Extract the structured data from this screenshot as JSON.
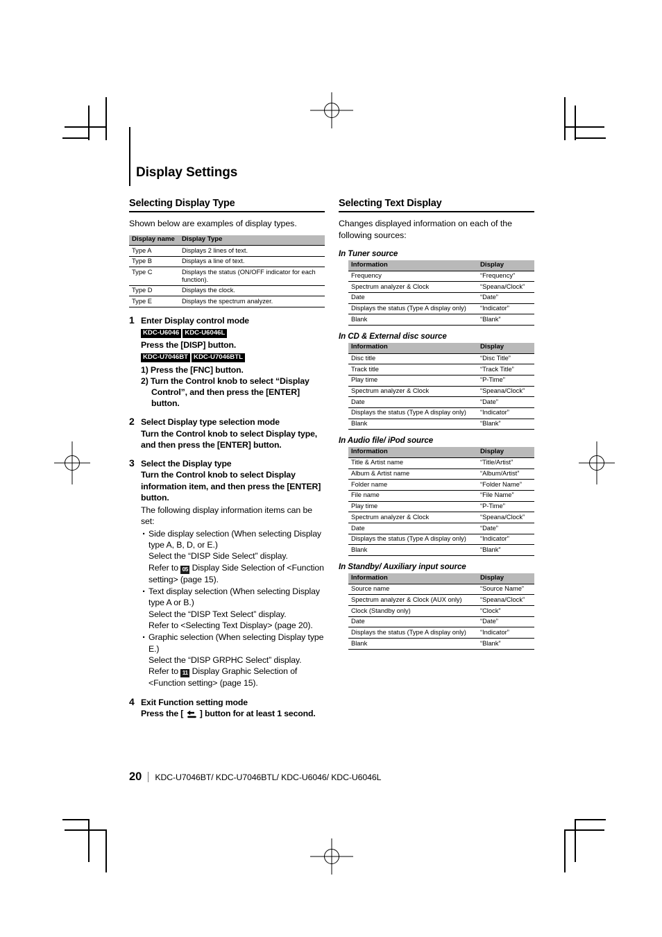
{
  "document": {
    "chapter_title": "Display Settings",
    "page_number": "20",
    "footer_models": "KDC-U7046BT/ KDC-U7046BTL/ KDC-U6046/ KDC-U6046L"
  },
  "left_column": {
    "section_title": "Selecting Display Type",
    "intro": "Shown below are examples of display types.",
    "type_table": {
      "headers": [
        "Display name",
        "Display Type"
      ],
      "rows": [
        [
          "Type A",
          "Displays 2 lines of text."
        ],
        [
          "Type B",
          "Displays a line of text."
        ],
        [
          "Type C",
          "Displays the status (ON/OFF indicator for each function)."
        ],
        [
          "Type D",
          "Displays the clock."
        ],
        [
          "Type E",
          "Displays the spectrum analyzer."
        ]
      ]
    },
    "steps": [
      {
        "num": "1",
        "heading": "Enter Display control mode",
        "models_a": [
          "KDC-U6046",
          "KDC-U6046L"
        ],
        "line_a": "Press the [DISP] button.",
        "models_b": [
          "KDC-U7046BT",
          "KDC-U7046BTL"
        ],
        "sub_1": "1) Press the [FNC] button.",
        "sub_2": "2) Turn the Control knob to select “Display Control”, and then press the [ENTER] button."
      },
      {
        "num": "2",
        "heading": "Select Display type selection mode",
        "body": "Turn the Control knob to select Display type, and then press the [ENTER] button."
      },
      {
        "num": "3",
        "heading": "Select the Display type",
        "body": "Turn the Control knob to select Display information item, and then press the [ENTER] button.",
        "plain": "The following display information items can be set:",
        "bullets": [
          {
            "line1": "Side display selection (When selecting Display type A, B, D, or E.)",
            "line2": "Select the “DISP Side Select” display.",
            "ref_icon": "05",
            "line3_pre": "Refer to ",
            "line3_post": " Display Side Selection of <Function setting> (page 15)."
          },
          {
            "line1": "Text display selection (When selecting Display type A or B.)",
            "line2": "Select the “DISP Text Select” display.",
            "line3_plain": "Refer to <Selecting Text Display> (page 20)."
          },
          {
            "line1": "Graphic selection (When selecting Display type E.)",
            "line2": "Select the “DISP GRPHC Select” display.",
            "ref_icon": "11",
            "line3_pre": "Refer to ",
            "line3_post": " Display Graphic Selection of <Function setting> (page 15)."
          }
        ]
      },
      {
        "num": "4",
        "heading": "Exit Function setting mode",
        "body_pre": "Press the [ ",
        "body_icon": "back-arrow-icon",
        "body_post": " ] button for at least 1 second."
      }
    ]
  },
  "right_column": {
    "section_title": "Selecting Text Display",
    "intro": "Changes displayed information on each of the following sources:",
    "table_headers": [
      "Information",
      "Display"
    ],
    "sources": [
      {
        "name": "In Tuner source",
        "rows": [
          [
            "Frequency",
            "“Frequency”"
          ],
          [
            "Spectrum analyzer & Clock",
            "“Speana/Clock”"
          ],
          [
            "Date",
            "“Date”"
          ],
          [
            "Displays the status (Type A display only)",
            "“Indicator”"
          ],
          [
            "Blank",
            "“Blank”"
          ]
        ]
      },
      {
        "name": "In CD & External disc source",
        "rows": [
          [
            "Disc title",
            "“Disc Title”"
          ],
          [
            "Track title",
            "“Track Title”"
          ],
          [
            "Play time",
            "“P-Time”"
          ],
          [
            "Spectrum analyzer & Clock",
            "“Speana/Clock”"
          ],
          [
            "Date",
            "“Date”"
          ],
          [
            "Displays the status (Type A display only)",
            "“Indicator”"
          ],
          [
            "Blank",
            "“Blank”"
          ]
        ]
      },
      {
        "name": "In Audio file/ iPod source",
        "rows": [
          [
            "Title & Artist name",
            "“Title/Artist”"
          ],
          [
            "Album & Artist name",
            "“Album/Artist”"
          ],
          [
            "Folder name",
            "“Folder Name”"
          ],
          [
            "File name",
            "“File Name”"
          ],
          [
            "Play time",
            "“P-Time”"
          ],
          [
            "Spectrum analyzer & Clock",
            "“Speana/Clock”"
          ],
          [
            "Date",
            "“Date”"
          ],
          [
            "Displays the status (Type A display only)",
            "“Indicator”"
          ],
          [
            "Blank",
            "“Blank”"
          ]
        ]
      },
      {
        "name": "In Standby/ Auxiliary input source",
        "rows": [
          [
            "Source name",
            "“Source Name”"
          ],
          [
            "Spectrum analyzer & Clock (AUX only)",
            "“Speana/Clock”"
          ],
          [
            "Clock (Standby only)",
            "“Clock”"
          ],
          [
            "Date",
            "“Date”"
          ],
          [
            "Displays the status (Type A display only)",
            "“Indicator”"
          ],
          [
            "Blank",
            "“Blank”"
          ]
        ]
      }
    ]
  }
}
